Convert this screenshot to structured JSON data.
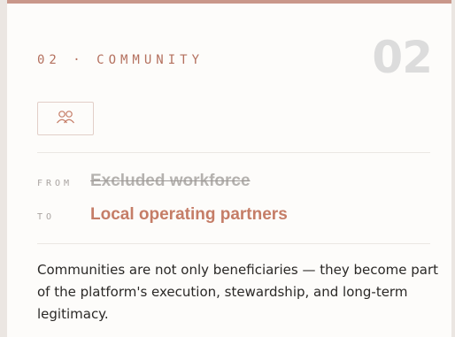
{
  "section": {
    "eyebrow": "02 · COMMUNITY",
    "number": "02",
    "icon": "people-icon"
  },
  "shift": {
    "from_label": "FROM",
    "from_value": "Excluded workforce",
    "to_label": "TO",
    "to_value": "Local operating partners"
  },
  "description": "Communities are not only beneficiaries — they become part of the platform's execution, stewardship, and long-term legitimacy.",
  "colors": {
    "accent": "#c57d67",
    "top_border": "#c9978a",
    "muted": "#b5b2af",
    "big_number": "#dcdcdc"
  }
}
